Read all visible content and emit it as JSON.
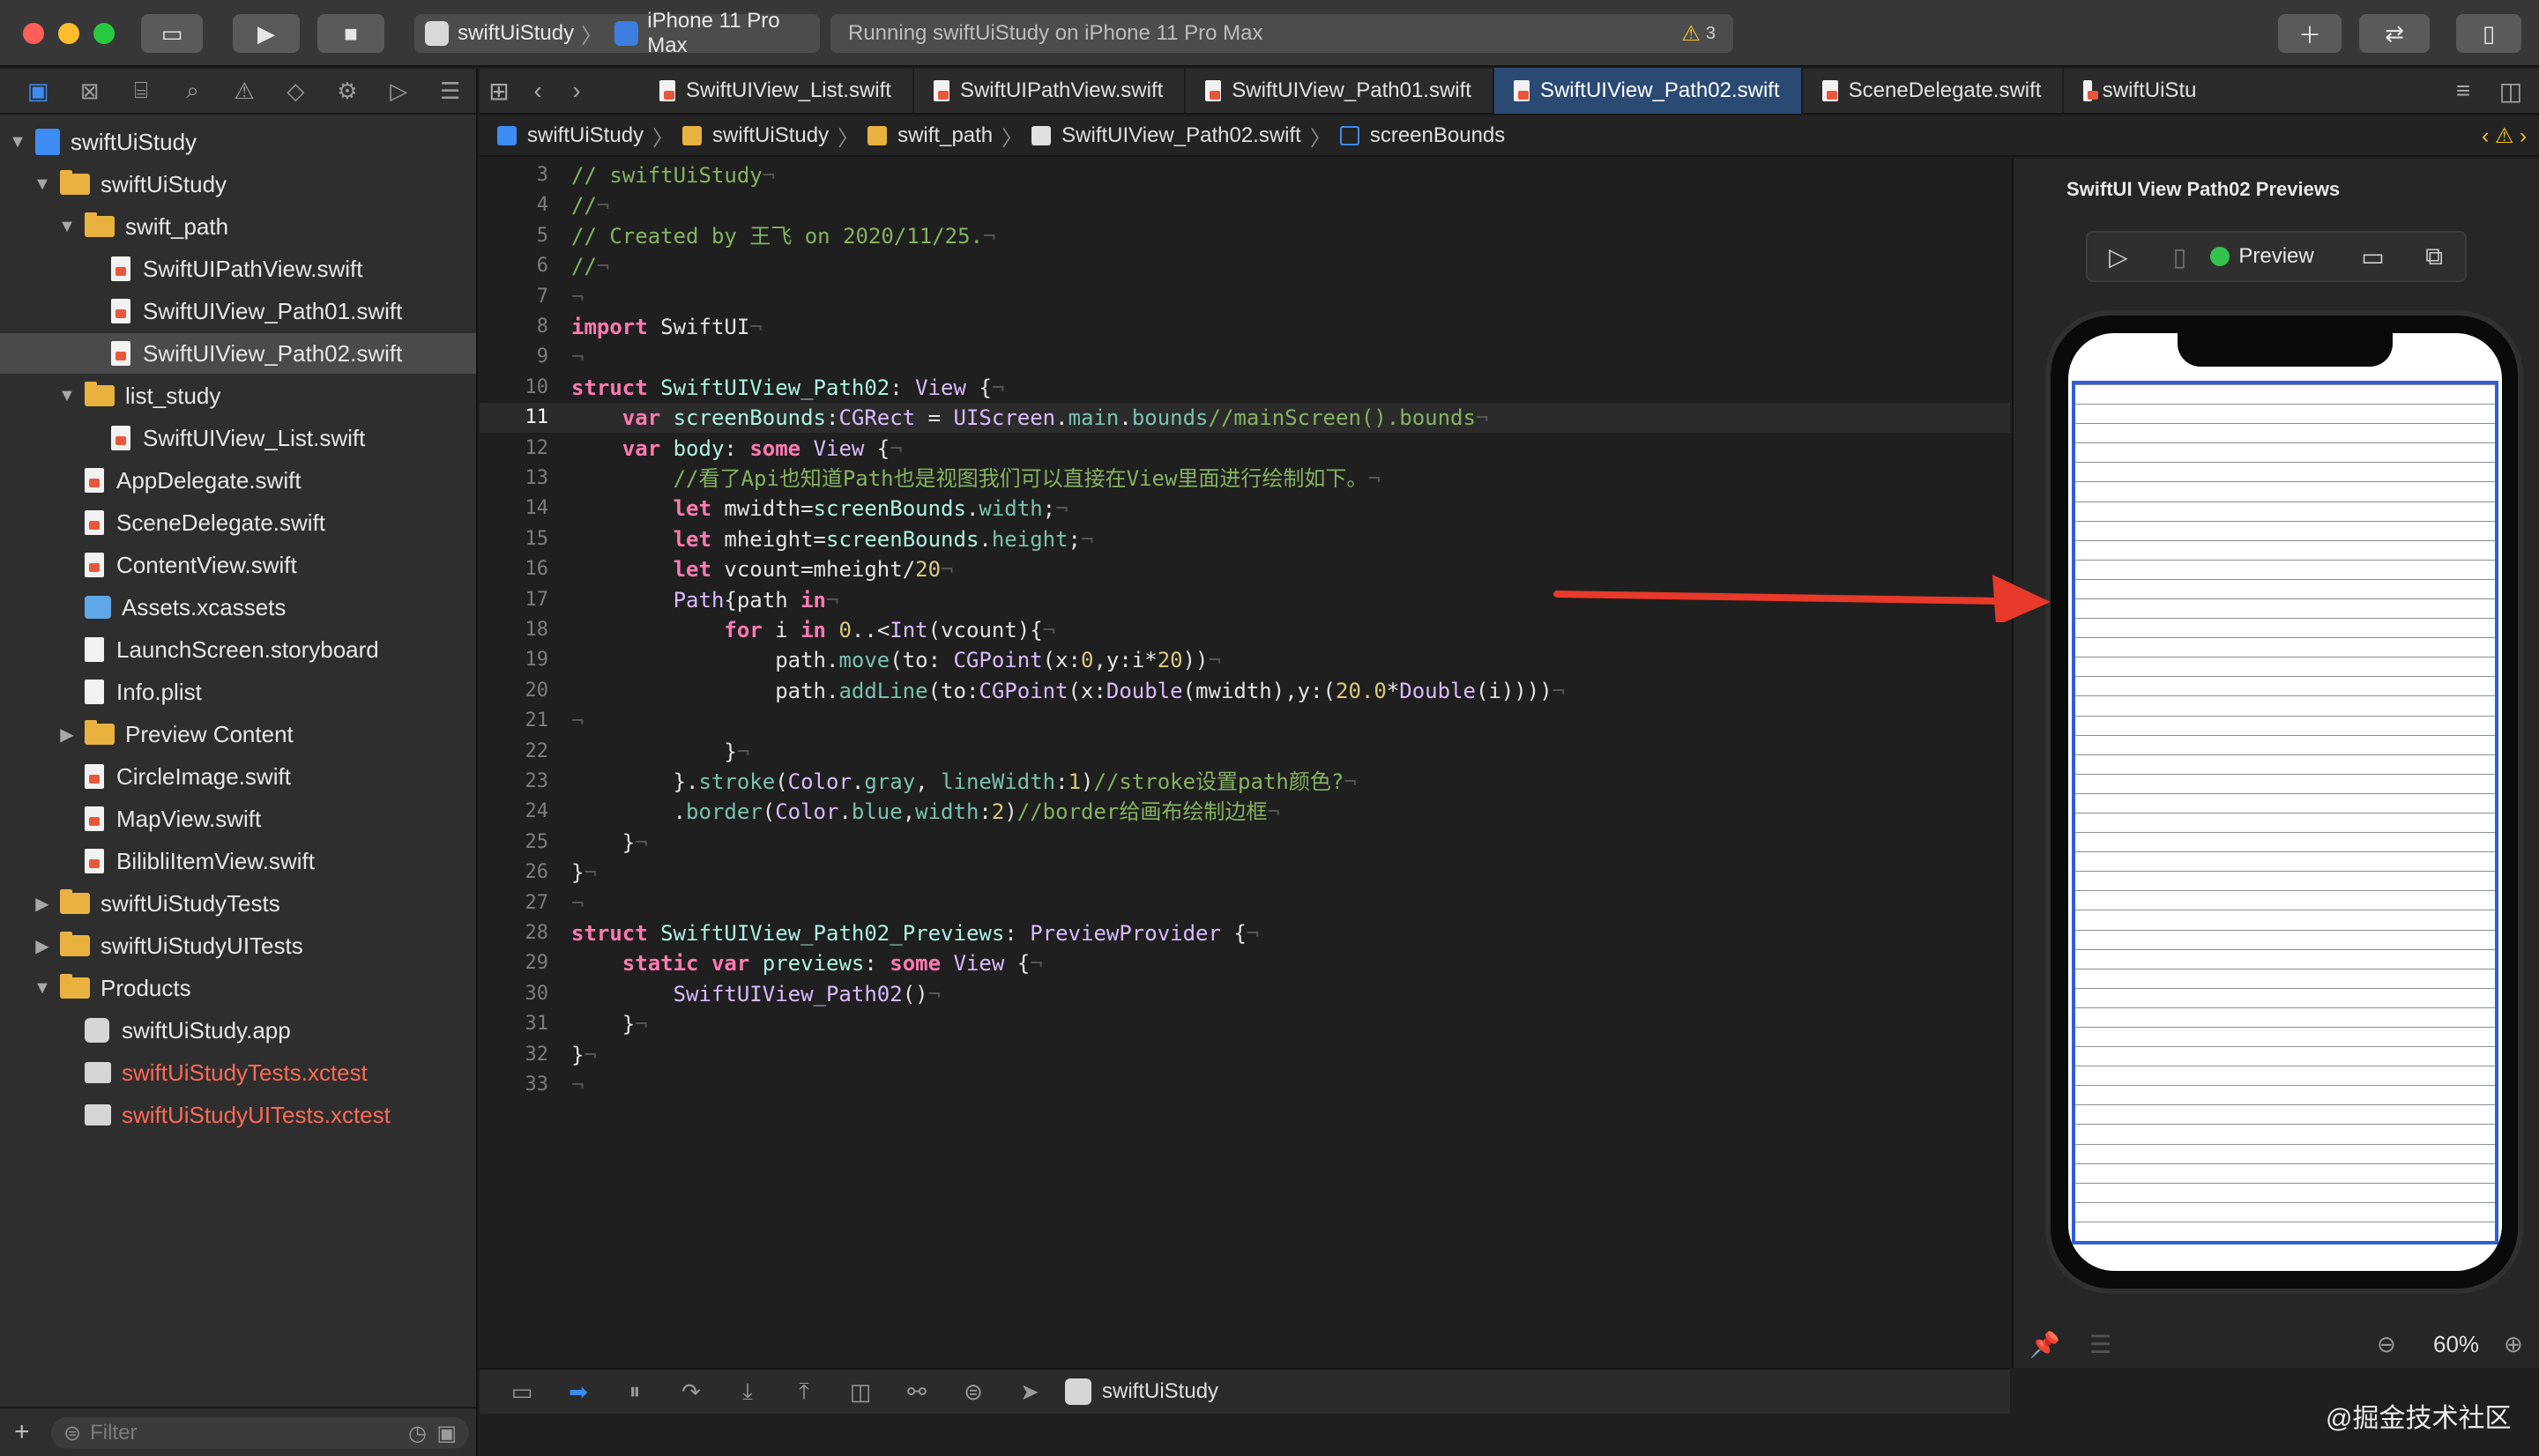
{
  "toolbar": {
    "scheme_target": "swiftUiStudy",
    "scheme_device": "iPhone 11 Pro Max",
    "activity_text": "Running swiftUiStudy on iPhone 11 Pro Max",
    "warning_count": "3",
    "traffic_colors": [
      "#ff5f57",
      "#febc2e",
      "#28c840"
    ]
  },
  "navigator": {
    "tabs": [
      "folder-icon",
      "source-control-icon",
      "hierarchy-icon",
      "search-icon",
      "warning-icon",
      "test-icon",
      "debug-icon",
      "breakpoint-icon",
      "report-icon"
    ],
    "rows": [
      {
        "label": "swiftUiStudy",
        "kind": "project",
        "depth": 0,
        "disclosure": "open"
      },
      {
        "label": "swiftUiStudy",
        "kind": "folder",
        "depth": 1,
        "disclosure": "open"
      },
      {
        "label": "swift_path",
        "kind": "folder",
        "depth": 2,
        "disclosure": "open"
      },
      {
        "label": "SwiftUIPathView.swift",
        "kind": "swift",
        "depth": 3
      },
      {
        "label": "SwiftUIView_Path01.swift",
        "kind": "swift",
        "depth": 3
      },
      {
        "label": "SwiftUIView_Path02.swift",
        "kind": "swift",
        "depth": 3,
        "selected": true
      },
      {
        "label": "list_study",
        "kind": "folder",
        "depth": 2,
        "disclosure": "open"
      },
      {
        "label": "SwiftUIView_List.swift",
        "kind": "swift",
        "depth": 3
      },
      {
        "label": "AppDelegate.swift",
        "kind": "swift",
        "depth": 2
      },
      {
        "label": "SceneDelegate.swift",
        "kind": "swift",
        "depth": 2
      },
      {
        "label": "ContentView.swift",
        "kind": "swift",
        "depth": 2
      },
      {
        "label": "Assets.xcassets",
        "kind": "assets",
        "depth": 2
      },
      {
        "label": "LaunchScreen.storyboard",
        "kind": "file",
        "depth": 2
      },
      {
        "label": "Info.plist",
        "kind": "file",
        "depth": 2
      },
      {
        "label": "Preview Content",
        "kind": "folder",
        "depth": 2,
        "disclosure": "closed"
      },
      {
        "label": "CircleImage.swift",
        "kind": "swift",
        "depth": 2
      },
      {
        "label": "MapView.swift",
        "kind": "swift",
        "depth": 2
      },
      {
        "label": "BilibliItemView.swift",
        "kind": "swift",
        "depth": 2
      },
      {
        "label": "swiftUiStudyTests",
        "kind": "folder",
        "depth": 1,
        "disclosure": "closed"
      },
      {
        "label": "swiftUiStudyUITests",
        "kind": "folder",
        "depth": 1,
        "disclosure": "closed"
      },
      {
        "label": "Products",
        "kind": "folder",
        "depth": 1,
        "disclosure": "open"
      },
      {
        "label": "swiftUiStudy.app",
        "kind": "app",
        "depth": 2
      },
      {
        "label": "swiftUiStudyTests.xctest",
        "kind": "xctest",
        "depth": 2,
        "red": true
      },
      {
        "label": "swiftUiStudyUITests.xctest",
        "kind": "xctest",
        "depth": 2,
        "red": true
      }
    ],
    "filter_placeholder": "Filter"
  },
  "tabs": [
    {
      "label": "SwiftUIView_List.swift",
      "active": false
    },
    {
      "label": "SwiftUIPathView.swift",
      "active": false
    },
    {
      "label": "SwiftUIView_Path01.swift",
      "active": false
    },
    {
      "label": "SwiftUIView_Path02.swift",
      "active": true
    },
    {
      "label": "SceneDelegate.swift",
      "active": false
    },
    {
      "label": "swiftUiStu",
      "active": false
    }
  ],
  "breadcrumb": [
    "swiftUiStudy",
    "swiftUiStudy",
    "swift_path",
    "SwiftUIView_Path02.swift",
    "screenBounds"
  ],
  "editor": {
    "current_line": 11,
    "lines": [
      {
        "n": 3,
        "segs": [
          [
            "c",
            "// swiftUiStudy"
          ]
        ]
      },
      {
        "n": 4,
        "segs": [
          [
            "c",
            "//"
          ]
        ]
      },
      {
        "n": 5,
        "segs": [
          [
            "c",
            "// Created by 王飞 on 2020/11/25."
          ]
        ]
      },
      {
        "n": 6,
        "segs": [
          [
            "c",
            "//"
          ]
        ]
      },
      {
        "n": 7,
        "segs": [
          [
            "",
            ""
          ]
        ]
      },
      {
        "n": 8,
        "segs": [
          [
            "k",
            "import"
          ],
          [
            "",
            " SwiftUI"
          ]
        ]
      },
      {
        "n": 9,
        "segs": [
          [
            "",
            ""
          ]
        ]
      },
      {
        "n": 10,
        "segs": [
          [
            "k",
            "struct"
          ],
          [
            "",
            " "
          ],
          [
            "ty",
            "SwiftUIView_Path02"
          ],
          [
            "",
            ": "
          ],
          [
            "t",
            "View"
          ],
          [
            "",
            " {"
          ]
        ]
      },
      {
        "n": 11,
        "segs": [
          [
            "",
            "    "
          ],
          [
            "k",
            "var"
          ],
          [
            "",
            " "
          ],
          [
            "ty",
            "screenBounds"
          ],
          [
            "",
            ":"
          ],
          [
            "t",
            "CGRect"
          ],
          [
            "",
            " = "
          ],
          [
            "t",
            "UIScreen"
          ],
          [
            "",
            "."
          ],
          [
            "p",
            "main"
          ],
          [
            "",
            "."
          ],
          [
            "p",
            "bounds"
          ],
          [
            "c",
            "//mainScreen().bounds"
          ]
        ]
      },
      {
        "n": 12,
        "segs": [
          [
            "",
            "    "
          ],
          [
            "k",
            "var"
          ],
          [
            "",
            " "
          ],
          [
            "ty",
            "body"
          ],
          [
            "",
            ": "
          ],
          [
            "k",
            "some"
          ],
          [
            "",
            " "
          ],
          [
            "t",
            "View"
          ],
          [
            "",
            " {"
          ]
        ]
      },
      {
        "n": 13,
        "segs": [
          [
            "",
            "        "
          ],
          [
            "c",
            "//看了Api也知道Path也是视图我们可以直接在View里面进行绘制如下。"
          ]
        ]
      },
      {
        "n": 14,
        "segs": [
          [
            "",
            "        "
          ],
          [
            "k",
            "let"
          ],
          [
            "",
            " mwidth="
          ],
          [
            "ty",
            "screenBounds"
          ],
          [
            "",
            "."
          ],
          [
            "p",
            "width"
          ],
          [
            "",
            ";"
          ]
        ]
      },
      {
        "n": 15,
        "segs": [
          [
            "",
            "        "
          ],
          [
            "k",
            "let"
          ],
          [
            "",
            " mheight="
          ],
          [
            "ty",
            "screenBounds"
          ],
          [
            "",
            "."
          ],
          [
            "p",
            "height"
          ],
          [
            "",
            ";"
          ]
        ]
      },
      {
        "n": 16,
        "segs": [
          [
            "",
            "        "
          ],
          [
            "k",
            "let"
          ],
          [
            "",
            " vcount=mheight/"
          ],
          [
            "n",
            "20"
          ]
        ]
      },
      {
        "n": 17,
        "segs": [
          [
            "",
            "        "
          ],
          [
            "t",
            "Path"
          ],
          [
            "",
            "{path "
          ],
          [
            "k",
            "in"
          ]
        ]
      },
      {
        "n": 18,
        "segs": [
          [
            "",
            "            "
          ],
          [
            "k",
            "for"
          ],
          [
            "",
            " i "
          ],
          [
            "k",
            "in"
          ],
          [
            "",
            " "
          ],
          [
            "n",
            "0"
          ],
          [
            "",
            "..<"
          ],
          [
            "t",
            "Int"
          ],
          [
            "",
            "(vcount){"
          ]
        ]
      },
      {
        "n": 19,
        "segs": [
          [
            "",
            "                path."
          ],
          [
            "p",
            "move"
          ],
          [
            "",
            "(to: "
          ],
          [
            "t",
            "CGPoint"
          ],
          [
            "",
            "(x:"
          ],
          [
            "n",
            "0"
          ],
          [
            "",
            ",y:i*"
          ],
          [
            "n",
            "20"
          ],
          [
            "",
            "))"
          ]
        ]
      },
      {
        "n": 20,
        "segs": [
          [
            "",
            "                path."
          ],
          [
            "p",
            "addLine"
          ],
          [
            "",
            "(to:"
          ],
          [
            "t",
            "CGPoint"
          ],
          [
            "",
            "(x:"
          ],
          [
            "t",
            "Double"
          ],
          [
            "",
            "(mwidth),y:("
          ],
          [
            "n",
            "20.0"
          ],
          [
            "",
            "*"
          ],
          [
            "t",
            "Double"
          ],
          [
            "",
            "(i))))"
          ]
        ]
      },
      {
        "n": 21,
        "segs": [
          [
            "",
            ""
          ]
        ]
      },
      {
        "n": 22,
        "segs": [
          [
            "",
            "            }"
          ]
        ]
      },
      {
        "n": 23,
        "segs": [
          [
            "",
            "        }."
          ],
          [
            "p",
            "stroke"
          ],
          [
            "",
            "("
          ],
          [
            "t",
            "Color"
          ],
          [
            "",
            "."
          ],
          [
            "p",
            "gray"
          ],
          [
            "",
            ", "
          ],
          [
            "p",
            "lineWidth"
          ],
          [
            "",
            ":"
          ],
          [
            "n",
            "1"
          ],
          [
            "",
            ")"
          ],
          [
            "c",
            "//stroke设置path颜色?"
          ]
        ]
      },
      {
        "n": 24,
        "segs": [
          [
            "",
            "        ."
          ],
          [
            "p",
            "border"
          ],
          [
            "",
            "("
          ],
          [
            "t",
            "Color"
          ],
          [
            "",
            "."
          ],
          [
            "p",
            "blue"
          ],
          [
            "",
            ","
          ],
          [
            "p",
            "width"
          ],
          [
            "",
            ":"
          ],
          [
            "n",
            "2"
          ],
          [
            "",
            ")"
          ],
          [
            "c",
            "//border给画布绘制边框"
          ]
        ]
      },
      {
        "n": 25,
        "segs": [
          [
            "",
            "    }"
          ]
        ]
      },
      {
        "n": 26,
        "segs": [
          [
            "",
            "}"
          ]
        ]
      },
      {
        "n": 27,
        "segs": [
          [
            "",
            ""
          ]
        ]
      },
      {
        "n": 28,
        "segs": [
          [
            "k",
            "struct"
          ],
          [
            "",
            " "
          ],
          [
            "ty",
            "SwiftUIView_Path02_Previews"
          ],
          [
            "",
            ": "
          ],
          [
            "t",
            "PreviewProvider"
          ],
          [
            "",
            " {"
          ]
        ]
      },
      {
        "n": 29,
        "segs": [
          [
            "",
            "    "
          ],
          [
            "k",
            "static"
          ],
          [
            "",
            " "
          ],
          [
            "k",
            "var"
          ],
          [
            "",
            " "
          ],
          [
            "ty",
            "previews"
          ],
          [
            "",
            ": "
          ],
          [
            "k",
            "some"
          ],
          [
            "",
            " "
          ],
          [
            "t",
            "View"
          ],
          [
            "",
            " {"
          ]
        ]
      },
      {
        "n": 30,
        "segs": [
          [
            "",
            "        "
          ],
          [
            "t",
            "SwiftUIView_Path02"
          ],
          [
            "",
            "()"
          ]
        ]
      },
      {
        "n": 31,
        "segs": [
          [
            "",
            "    }"
          ]
        ]
      },
      {
        "n": 32,
        "segs": [
          [
            "",
            "}"
          ]
        ]
      },
      {
        "n": 33,
        "segs": [
          [
            "",
            ""
          ]
        ]
      }
    ]
  },
  "canvas": {
    "title": "SwiftUI View Path02 Previews",
    "preview_label": "Preview",
    "zoom": "60%",
    "line_count": 44,
    "line_color": "#8e8e93",
    "border_color": "#2f5fd8"
  },
  "debug": {
    "target_label": "swiftUiStudy"
  },
  "watermark": "@掘金技术社区",
  "colors": {
    "accent": "#3c8cf4",
    "annotation_arrow": "#e8392a"
  }
}
